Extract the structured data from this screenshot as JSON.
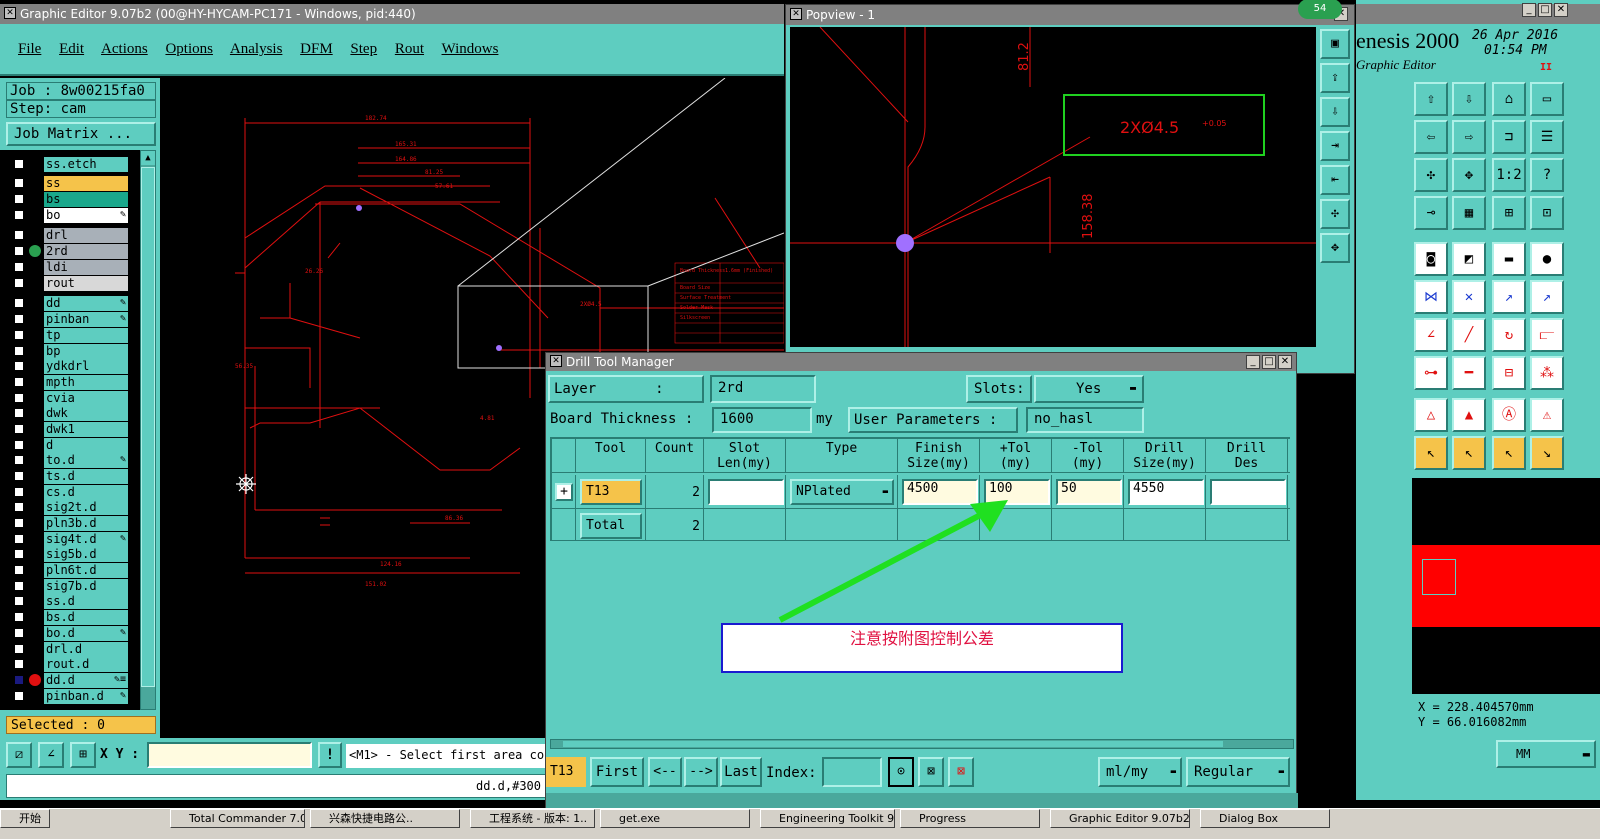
{
  "main_window": {
    "title": "Graphic Editor 9.07b2 (00@HY-HYCAM-PC171 - Windows, pid:440)",
    "menu": [
      "File",
      "Edit",
      "Actions",
      "Options",
      "Analysis",
      "DFM",
      "Step",
      "Rout",
      "Windows"
    ],
    "job_label": "Job : 8w00215fa0",
    "step_label": "Step: cam",
    "job_matrix": "Job Matrix ...",
    "brand": "enesis 2000",
    "date": "26 Apr 2016",
    "time": "01:54 PM",
    "subtitle": "Graphic Editor",
    "selected": "Selected : 0",
    "xy_label": "X Y :",
    "xy_value": "",
    "prompt": "<M1> - Select first area cor",
    "status_layer": "dd.d,#300",
    "coord_x": "X  =  228.404570mm",
    "coord_y": "Y  =  66.016082mm",
    "units": "MM",
    "badge": "54"
  },
  "layers": [
    {
      "name": "ss.etch",
      "color": "#5ecdc0",
      "flag": ""
    },
    {
      "name": "ss",
      "color": "#f5c34a",
      "flag": ""
    },
    {
      "name": "bs",
      "color": "#1aa88c",
      "flag": ""
    },
    {
      "name": "bo",
      "color": "#ffffff",
      "flag": "✎"
    },
    {
      "name": "drl",
      "color": "#a8b0b8",
      "flag": ""
    },
    {
      "name": "2rd",
      "color": "#a8b0b8",
      "flag": ""
    },
    {
      "name": "ldi",
      "color": "#a8b0b8",
      "flag": ""
    },
    {
      "name": "rout",
      "color": "#d8d8d8",
      "flag": ""
    },
    {
      "name": "dd",
      "color": "#5ecdc0",
      "flag": "✎"
    },
    {
      "name": "pinban",
      "color": "#5ecdc0",
      "flag": "✎"
    },
    {
      "name": "tp",
      "color": "#5ecdc0",
      "flag": ""
    },
    {
      "name": "bp",
      "color": "#5ecdc0",
      "flag": ""
    },
    {
      "name": "ydkdrl",
      "color": "#5ecdc0",
      "flag": ""
    },
    {
      "name": "mpth",
      "color": "#5ecdc0",
      "flag": ""
    },
    {
      "name": "cvia",
      "color": "#5ecdc0",
      "flag": ""
    },
    {
      "name": "dwk",
      "color": "#5ecdc0",
      "flag": ""
    },
    {
      "name": "dwk1",
      "color": "#5ecdc0",
      "flag": ""
    },
    {
      "name": "d",
      "color": "#5ecdc0",
      "flag": ""
    },
    {
      "name": "to.d",
      "color": "#5ecdc0",
      "flag": "✎"
    },
    {
      "name": "ts.d",
      "color": "#5ecdc0",
      "flag": ""
    },
    {
      "name": "cs.d",
      "color": "#5ecdc0",
      "flag": ""
    },
    {
      "name": "sig2t.d",
      "color": "#5ecdc0",
      "flag": ""
    },
    {
      "name": "pln3b.d",
      "color": "#5ecdc0",
      "flag": ""
    },
    {
      "name": "sig4t.d",
      "color": "#5ecdc0",
      "flag": "✎"
    },
    {
      "name": "sig5b.d",
      "color": "#5ecdc0",
      "flag": ""
    },
    {
      "name": "pln6t.d",
      "color": "#5ecdc0",
      "flag": ""
    },
    {
      "name": "sig7b.d",
      "color": "#5ecdc0",
      "flag": ""
    },
    {
      "name": "ss.d",
      "color": "#5ecdc0",
      "flag": ""
    },
    {
      "name": "bs.d",
      "color": "#5ecdc0",
      "flag": ""
    },
    {
      "name": "bo.d",
      "color": "#5ecdc0",
      "flag": "✎"
    },
    {
      "name": "drl.d",
      "color": "#5ecdc0",
      "flag": ""
    },
    {
      "name": "rout.d",
      "color": "#5ecdc0",
      "flag": ""
    },
    {
      "name": "dd.d",
      "color": "#5ecdc0",
      "flag": "✎≡"
    },
    {
      "name": "pinban.d",
      "color": "#5ecdc0",
      "flag": "✎"
    }
  ],
  "popview": {
    "title": "Popview - 1",
    "annotation": "2XØ4.5",
    "tol": "+0.05",
    "dim_v1": "81.2",
    "dim_v2": "158.38"
  },
  "drill_manager": {
    "title": "Drill Tool Manager",
    "layer_label": "Layer       :",
    "layer_value": "2rd",
    "slots_label": "Slots:",
    "slots_value": "Yes",
    "thickness_label": "Board Thickness :",
    "thickness_value": "1600",
    "thickness_unit": "my",
    "user_params_label": "User Parameters :",
    "user_params_value": "no_hasl",
    "columns": [
      "Tool",
      "Count",
      "Slot\nLen(my)",
      "Type",
      "Finish\nSize(my)",
      "+Tol\n(my)",
      "-Tol\n(my)",
      "Drill\nSize(my)",
      "Drill\nDes"
    ],
    "row": {
      "tool": "T13",
      "count": "2",
      "slot_len": "",
      "type": "NPlated",
      "finish": "4500",
      "plus_tol": "100",
      "minus_tol": "50",
      "drill_size": "4550",
      "drill_des": ""
    },
    "total": {
      "label": "Total",
      "count": "2"
    },
    "note": "注意按附图控制公差",
    "current_tool": "T13",
    "nav": [
      "First",
      "<--",
      "-->",
      "Last"
    ],
    "index_label": "Index:",
    "index_value": "",
    "unit_select": "ml/my",
    "mode_select": "Regular"
  },
  "taskbar": [
    "开始",
    "Total Commander 7.0",
    "兴森快捷电路公..",
    "工程系统 - 版本: 1..",
    "get.exe",
    "Engineering Toolkit 9..",
    "Progress",
    "Graphic Editor 9.07b2",
    "Dialog Box"
  ],
  "drawing": {
    "dims": [
      "182.74",
      "165.31",
      "164.86",
      "81.25",
      "57.61",
      "26.26",
      "56.35",
      "2XØ4.5",
      "124.16",
      "151.02",
      "86.36",
      "4.81"
    ],
    "title_block": [
      "Board Thickness",
      "1.6mm (Finished)",
      "Board Size",
      "Surface Treatment",
      "Solder Mask",
      "Silkscreen"
    ]
  }
}
